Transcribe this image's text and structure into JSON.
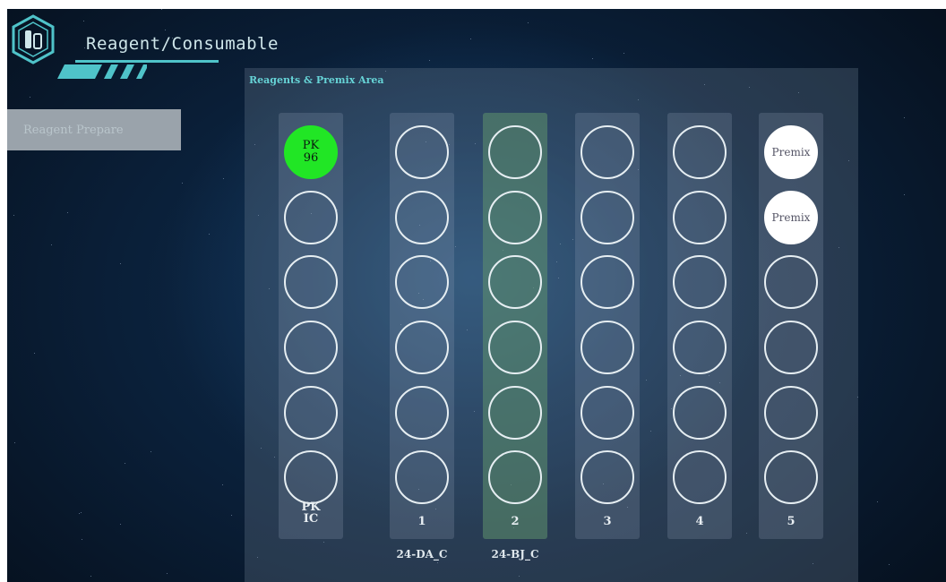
{
  "header": {
    "title": "Reagent/Consumable",
    "logo_icon": "reagent-tubes-icon"
  },
  "sidebar": {
    "items": [
      {
        "label": "Reagent Prepare",
        "active": true
      }
    ]
  },
  "panel": {
    "title": "Reagents & Premix Area",
    "columns": [
      {
        "label": "PK\nIC",
        "sub": "",
        "selected": false,
        "wells": [
          {
            "text": "PK\n96",
            "state": "green"
          },
          {
            "text": "",
            "state": "empty"
          },
          {
            "text": "",
            "state": "empty"
          },
          {
            "text": "",
            "state": "empty"
          },
          {
            "text": "",
            "state": "empty"
          },
          {
            "text": "",
            "state": "empty"
          }
        ]
      },
      {
        "label": "1",
        "sub": "24-DA_C",
        "selected": false,
        "wells": [
          {
            "text": "",
            "state": "empty"
          },
          {
            "text": "",
            "state": "empty"
          },
          {
            "text": "",
            "state": "empty"
          },
          {
            "text": "",
            "state": "empty"
          },
          {
            "text": "",
            "state": "empty"
          },
          {
            "text": "",
            "state": "empty"
          }
        ]
      },
      {
        "label": "2",
        "sub": "24-BJ_C",
        "selected": true,
        "wells": [
          {
            "text": "",
            "state": "empty"
          },
          {
            "text": "",
            "state": "empty"
          },
          {
            "text": "",
            "state": "empty"
          },
          {
            "text": "",
            "state": "empty"
          },
          {
            "text": "",
            "state": "empty"
          },
          {
            "text": "",
            "state": "empty"
          }
        ]
      },
      {
        "label": "3",
        "sub": "",
        "selected": false,
        "wells": [
          {
            "text": "",
            "state": "empty"
          },
          {
            "text": "",
            "state": "empty"
          },
          {
            "text": "",
            "state": "empty"
          },
          {
            "text": "",
            "state": "empty"
          },
          {
            "text": "",
            "state": "empty"
          },
          {
            "text": "",
            "state": "empty"
          }
        ]
      },
      {
        "label": "4",
        "sub": "",
        "selected": false,
        "wells": [
          {
            "text": "",
            "state": "empty"
          },
          {
            "text": "",
            "state": "empty"
          },
          {
            "text": "",
            "state": "empty"
          },
          {
            "text": "",
            "state": "empty"
          },
          {
            "text": "",
            "state": "empty"
          },
          {
            "text": "",
            "state": "empty"
          }
        ]
      },
      {
        "label": "5",
        "sub": "",
        "selected": false,
        "wells": [
          {
            "text": "Premix",
            "state": "white"
          },
          {
            "text": "Premix",
            "state": "white"
          },
          {
            "text": "",
            "state": "empty"
          },
          {
            "text": "",
            "state": "empty"
          },
          {
            "text": "",
            "state": "empty"
          },
          {
            "text": "",
            "state": "empty"
          }
        ]
      }
    ]
  },
  "colors": {
    "accent": "#4fc3c9",
    "loaded_well": "#21e625",
    "premix_well": "#ffffff",
    "selected_column": "#5f916e"
  }
}
